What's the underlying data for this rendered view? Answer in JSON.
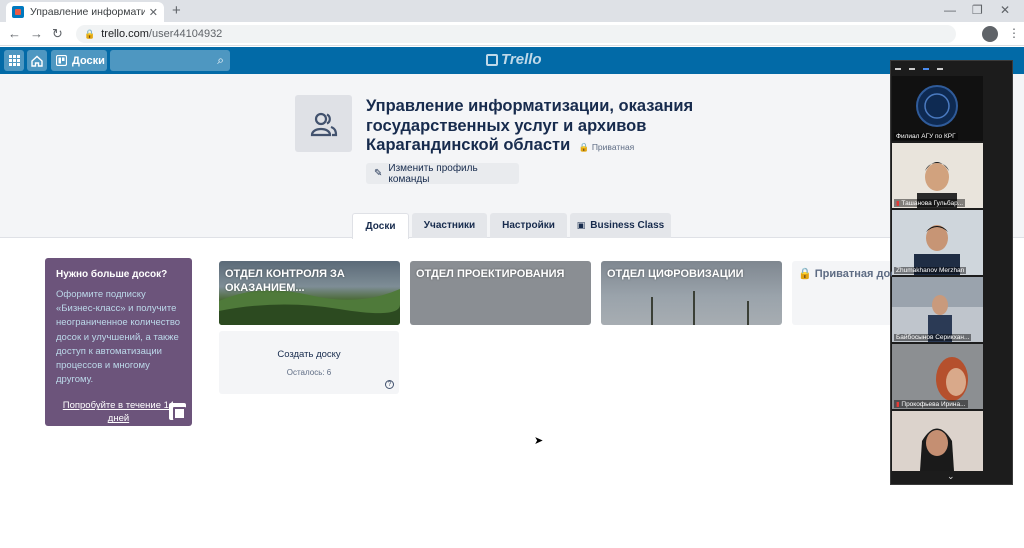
{
  "browser": {
    "tab_title": "Управление информатизации, с",
    "tab_close": "✕",
    "new_tab": "+",
    "url_host": "trello.com",
    "url_path": "/user44104932"
  },
  "trello": {
    "boards_button": "Доски",
    "logo_text": "Trello"
  },
  "team": {
    "name": "Управление информатизации, оказания государственных услуг и архивов Карагандинской области",
    "visibility": "Приватная",
    "edit_profile": "Изменить профиль команды",
    "tabs": [
      {
        "label": "Доски"
      },
      {
        "label": "Участники"
      },
      {
        "label": "Настройки"
      },
      {
        "label": "Business Class"
      }
    ]
  },
  "promo": {
    "heading": "Нужно больше досок?",
    "body": "Оформите подписку «Бизнес-класс» и получите неограниченное количество досок и улучшений, а также доступ к автоматизации процессов и многому другому.",
    "cta": "Попробуйте в течение 14 дней"
  },
  "boards": [
    {
      "title": "ОТДЕЛ КОНТРОЛЯ ЗА ОКАЗАНИЕМ..."
    },
    {
      "title": "ОТДЕЛ ПРОЕКТИРОВАНИЯ"
    },
    {
      "title": "ОТДЕЛ ЦИФРОВИЗАЦИИ"
    },
    {
      "title": "Приватная дос"
    }
  ],
  "create_board": {
    "label": "Создать доску",
    "remaining": "Осталось: 6",
    "help": "?"
  },
  "video_call": {
    "participants": [
      {
        "name": "Филиал АГУ по КРГ"
      },
      {
        "name": "Ташанова Гульбар..."
      },
      {
        "name": "Zhumakhanov Merzhan"
      },
      {
        "name": "Байбосынов Серикхан..."
      },
      {
        "name": "Прокофьева Ирина..."
      },
      {
        "name": ""
      }
    ]
  },
  "colors": {
    "trello_header": "#026aa7",
    "promo_bg": "#6c547b",
    "private_red": "#eb5a46"
  }
}
